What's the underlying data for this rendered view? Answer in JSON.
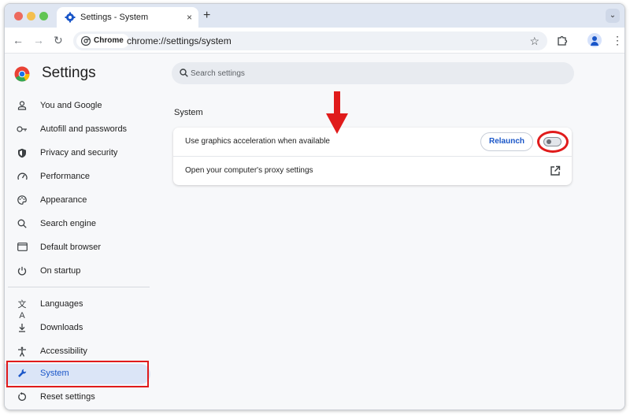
{
  "browser": {
    "tab_title": "Settings - System",
    "tab_close": "×",
    "new_tab": "+",
    "tab_search": "⌄",
    "back": "←",
    "forward": "→",
    "reload": "↻",
    "chip_label": "Chrome",
    "url": "chrome://settings/system",
    "bookmark": "☆",
    "menu": "⋮"
  },
  "app": {
    "title": "Settings",
    "search_placeholder": "Search settings"
  },
  "sidebar": {
    "items": [
      {
        "label": "You and Google",
        "icon": "person-icon"
      },
      {
        "label": "Autofill and passwords",
        "icon": "key-icon"
      },
      {
        "label": "Privacy and security",
        "icon": "shield-icon"
      },
      {
        "label": "Performance",
        "icon": "speedometer-icon"
      },
      {
        "label": "Appearance",
        "icon": "palette-icon"
      },
      {
        "label": "Search engine",
        "icon": "search-icon"
      },
      {
        "label": "Default browser",
        "icon": "browser-window-icon"
      },
      {
        "label": "On startup",
        "icon": "power-icon"
      },
      {
        "label": "Languages",
        "icon": "translate-icon"
      },
      {
        "label": "Downloads",
        "icon": "download-icon"
      },
      {
        "label": "Accessibility",
        "icon": "accessibility-icon"
      },
      {
        "label": "System",
        "icon": "wrench-icon",
        "active": true
      },
      {
        "label": "Reset settings",
        "icon": "reset-icon"
      }
    ]
  },
  "main": {
    "section_title": "System",
    "rows": [
      {
        "label": "Use graphics acceleration when available",
        "button": "Relaunch",
        "toggle_on": false
      },
      {
        "label": "Open your computer's proxy settings",
        "icon": "external-link-icon"
      }
    ]
  },
  "colors": {
    "accent": "#1a56c8",
    "annotation_red": "#e01b1b",
    "active_nav_bg": "#dbe5f7"
  }
}
